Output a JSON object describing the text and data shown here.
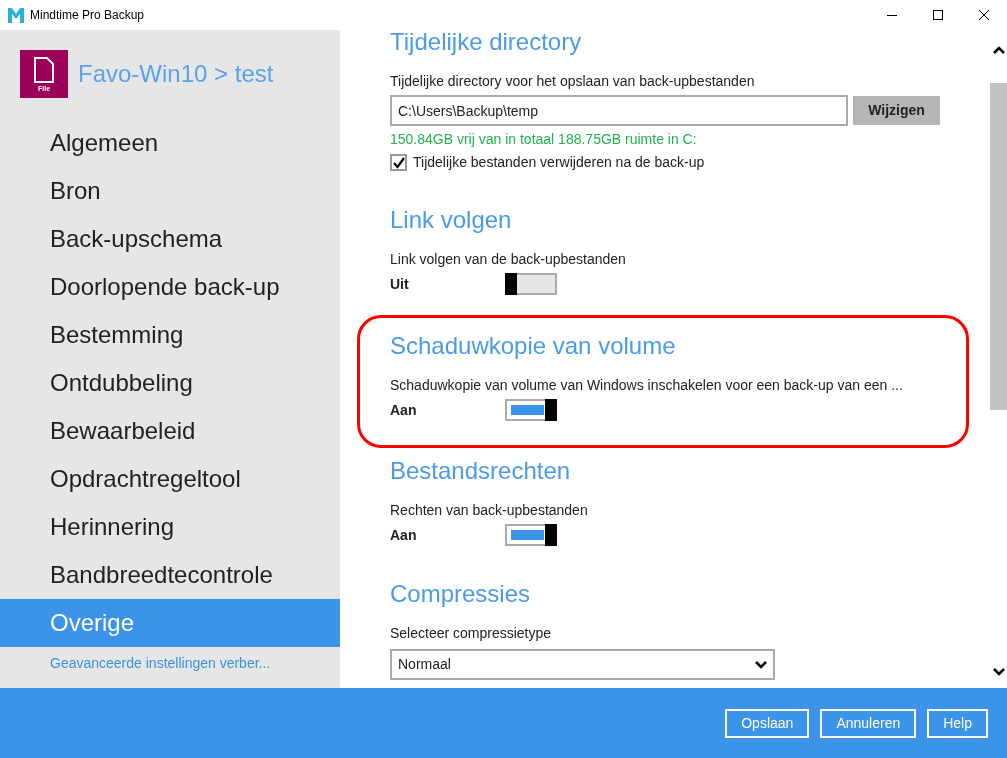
{
  "window": {
    "title": "Mindtime Pro Backup"
  },
  "sidebar": {
    "backup_set": "Favo-Win10 > test",
    "file_icon_label": "File",
    "items": [
      {
        "label": "Algemeen",
        "selected": false
      },
      {
        "label": "Bron",
        "selected": false
      },
      {
        "label": "Back-upschema",
        "selected": false
      },
      {
        "label": "Doorlopende back-up",
        "selected": false
      },
      {
        "label": "Bestemming",
        "selected": false
      },
      {
        "label": "Ontdubbeling",
        "selected": false
      },
      {
        "label": "Bewaarbeleid",
        "selected": false
      },
      {
        "label": "Opdrachtregeltool",
        "selected": false
      },
      {
        "label": "Herinnering",
        "selected": false
      },
      {
        "label": "Bandbreedtecontrole",
        "selected": false
      },
      {
        "label": "Overige",
        "selected": true
      }
    ],
    "advanced_link": "Geavanceerde instellingen verber..."
  },
  "sections": [
    {
      "kind": "path",
      "title": "Tijdelijke directory",
      "highlighted": false,
      "label": "Tijdelijke directory voor het opslaan van back-upbestanden",
      "value": "C:\\Users\\Backup\\temp",
      "button": "Wijzigen",
      "free_space": "150.84GB vrij van in totaal 188.75GB ruimte in C:",
      "checkbox": {
        "label": "Tijdelijke bestanden verwijderen na de back-up",
        "checked": true
      }
    },
    {
      "kind": "toggle",
      "title": "Link volgen",
      "highlighted": false,
      "label": "Link volgen van de back-upbestanden",
      "state_text": "Uit",
      "on": false
    },
    {
      "kind": "toggle",
      "title": "Schaduwkopie van volume",
      "highlighted": true,
      "label": "Schaduwkopie van volume van Windows inschakelen voor een back-up van een ...",
      "state_text": "Aan",
      "on": true
    },
    {
      "kind": "toggle",
      "title": "Bestandsrechten",
      "highlighted": false,
      "label": "Rechten van back-upbestanden",
      "state_text": "Aan",
      "on": true
    },
    {
      "kind": "select",
      "title": "Compressies",
      "highlighted": false,
      "label": "Selecteer compressietype",
      "value": "Normaal"
    }
  ],
  "footer": {
    "buttons": [
      "Opslaan",
      "Annuleren",
      "Help"
    ]
  }
}
